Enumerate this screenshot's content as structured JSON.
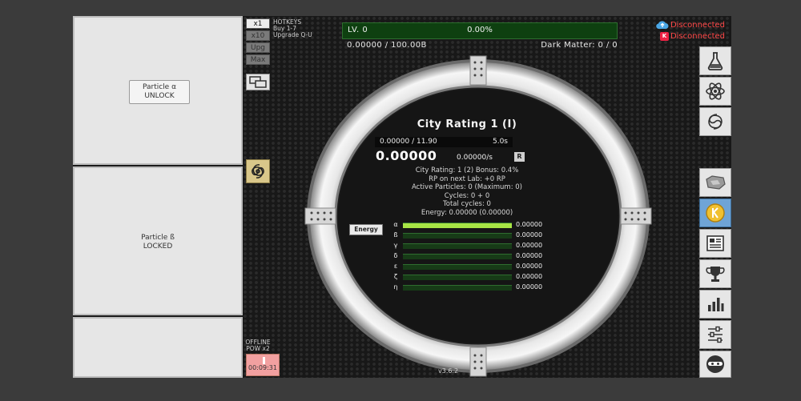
{
  "particles": [
    {
      "name": "Particle α",
      "action": "UNLOCK"
    },
    {
      "name": "Particle ß",
      "status": "LOCKED"
    }
  ],
  "buy_controls": {
    "x1": "x1",
    "x10": "x10",
    "upg": "Upg",
    "max": "Max",
    "hotkeys_title": "HOTKEYS",
    "hotkeys_buy": "Buy 1-7",
    "hotkeys_upgrade": "Upgrade Q-U"
  },
  "level": {
    "label": "LV. 0",
    "percent": "0.00%",
    "progress": "0.00000 / 100.00B",
    "fill_fraction": 0.0
  },
  "dark_matter": "Dark Matter: 0 / 0",
  "connection": {
    "cloud_status": "Disconnected",
    "k_status": "Disconnected",
    "k_letter": "K",
    "status_color": "#ff4747"
  },
  "city": {
    "title": "City Rating 1 (I)",
    "cycle_progress": "0.00000 / 11.90",
    "cycle_time": "5.0s",
    "rp_value": "0.00000",
    "rp_rate": "0.00000/s",
    "r_button": "R",
    "stats": [
      "City Rating: 1 (2) Bonus: 0.4%",
      "RP on next Lab: +0 RP",
      "Active Particles: 0 (Maximum: 0)",
      "Cycles: 0 + 0",
      "Total cycles: 0",
      "Energy: 0.00000 (0.00000)"
    ]
  },
  "energy": {
    "button": "Energy",
    "rows": [
      {
        "greek": "α",
        "value": "0.00000",
        "fill": 1.0
      },
      {
        "greek": "ß",
        "value": "0.00000",
        "fill": 0.0
      },
      {
        "greek": "γ",
        "value": "0.00000",
        "fill": 0.0
      },
      {
        "greek": "δ",
        "value": "0.00000",
        "fill": 0.0
      },
      {
        "greek": "ε",
        "value": "0.00000",
        "fill": 0.0
      },
      {
        "greek": "ζ",
        "value": "0.00000",
        "fill": 0.0
      },
      {
        "greek": "η",
        "value": "0.00000",
        "fill": 0.0
      }
    ],
    "fill_color": "#a8e545"
  },
  "offline": {
    "label_1": "OFFLINE",
    "label_2": "POW x2",
    "timer": "00:09:31"
  },
  "version": "v3.6.2",
  "menu_icons": [
    "flask-icon",
    "atom-icon",
    "galaxy-icon",
    "resource-icon",
    "k-coin-icon",
    "newspaper-icon",
    "trophy-icon",
    "stats-icon",
    "settings-icon",
    "ninja-icon"
  ]
}
